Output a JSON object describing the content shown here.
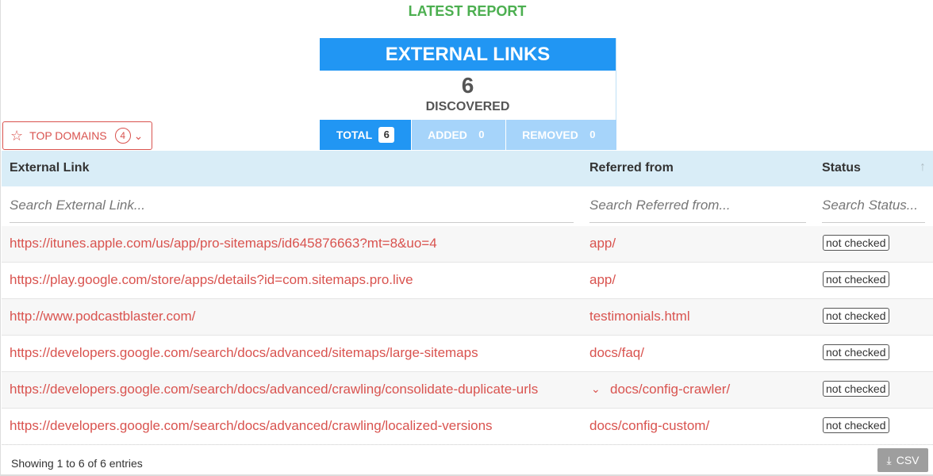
{
  "report": {
    "title": "LATEST REPORT"
  },
  "summary": {
    "heading": "EXTERNAL LINKS",
    "count": "6",
    "subtitle": "DISCOVERED",
    "tabs": [
      {
        "label": "TOTAL",
        "value": "6"
      },
      {
        "label": "ADDED",
        "value": "0"
      },
      {
        "label": "REMOVED",
        "value": "0"
      }
    ]
  },
  "top_domains": {
    "label": "TOP DOMAINS",
    "count": "4",
    "icon": "star-icon"
  },
  "table": {
    "columns": [
      "External Link",
      "Referred from",
      "Status"
    ],
    "filters": [
      "Search External Link...",
      "Search Referred from...",
      "Search Status..."
    ],
    "rows": [
      {
        "link": "https://itunes.apple.com/us/app/pro-sitemaps/id645876663?mt=8&uo=4",
        "ref": "app/",
        "status": "not checked"
      },
      {
        "link": "https://play.google.com/store/apps/details?id=com.sitemaps.pro.live",
        "ref": "app/",
        "status": "not checked"
      },
      {
        "link": "http://www.podcastblaster.com/",
        "ref": "testimonials.html",
        "status": "not checked"
      },
      {
        "link": "https://developers.google.com/search/docs/advanced/sitemaps/large-sitemaps",
        "ref": "docs/faq/",
        "status": "not checked"
      },
      {
        "link": "https://developers.google.com/search/docs/advanced/crawling/consolidate-duplicate-urls",
        "ref": "docs/config-crawler/",
        "status": "not checked"
      },
      {
        "link": "https://developers.google.com/search/docs/advanced/crawling/localized-versions",
        "ref": "docs/config-custom/",
        "status": "not checked"
      }
    ]
  },
  "footer": {
    "info": "Showing 1 to 6 of 6 entries",
    "csv_label": "CSV"
  },
  "colors": {
    "primary": "#2196f3",
    "light": "#a6d4fa",
    "link": "#d9534f",
    "title": "#4caf50",
    "header_bg": "#d9edf7"
  }
}
